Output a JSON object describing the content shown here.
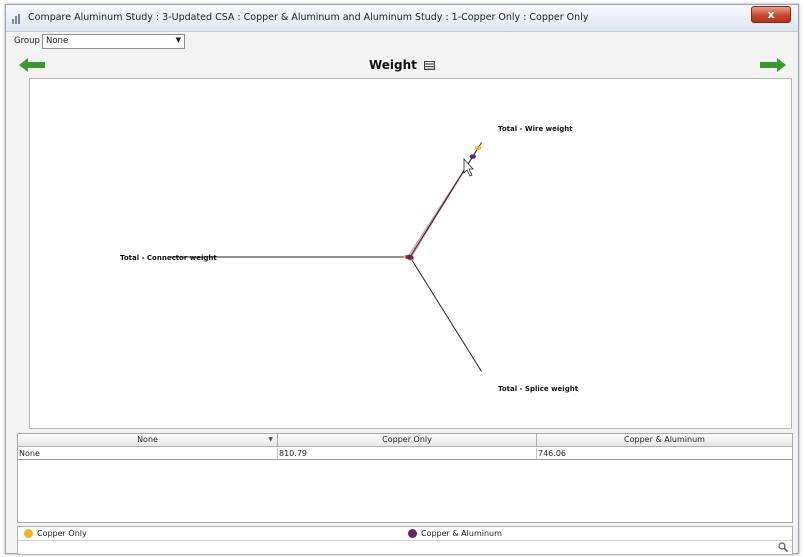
{
  "window": {
    "title": "Compare Aluminum Study : 3-Updated CSA : Copper & Aluminum and Aluminum Study : 1-Copper Only : Copper Only",
    "close_label": "x"
  },
  "group": {
    "label": "Group",
    "value": "None"
  },
  "chart": {
    "title": "Weight"
  },
  "chart_data": {
    "type": "radar",
    "axes": [
      "Total - Wire weight",
      "Total - Connector weight",
      "Total - Splice weight"
    ],
    "series": [
      {
        "name": "Copper Only",
        "color": "#f2b31c",
        "values": [
          810.79,
          0,
          0
        ]
      },
      {
        "name": "Copper & Aluminum",
        "color": "#6b1f6e",
        "values": [
          746.06,
          0,
          0
        ]
      }
    ],
    "axis_max": 850
  },
  "table": {
    "columns": [
      "None",
      "Copper Only",
      "Copper & Aluminum"
    ],
    "rows": [
      [
        "None",
        "810.79",
        "746.06"
      ]
    ]
  },
  "legend": {
    "items": [
      {
        "label": "Copper Only",
        "color": "#f2b31c"
      },
      {
        "label": "Copper & Aluminum",
        "color": "#6b1f6e"
      }
    ]
  },
  "colors": {
    "nav_arrow": "#3a9a2e",
    "fill": "#f3d2d6"
  }
}
